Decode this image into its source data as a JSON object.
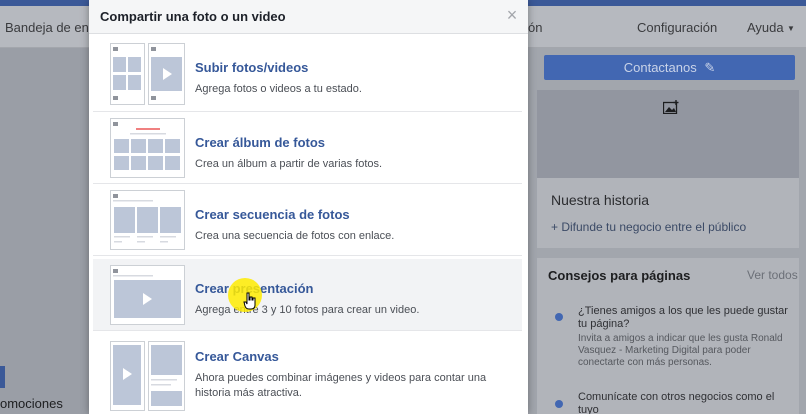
{
  "background": {
    "nav": {
      "inbox_partial": "Bandeja de entr",
      "notifications_partial": "ón",
      "settings": "Configuración",
      "help": "Ayuda",
      "help_caret": "▼"
    },
    "left_partial_text": "omociones",
    "contact_button": "Contactanos",
    "story": {
      "title": "Nuestra historia",
      "link": "+ Difunde tu negocio entre el público"
    },
    "tips": {
      "title": "Consejos para páginas",
      "see_all": "Ver todos",
      "items": [
        {
          "question": "¿Tienes amigos a los que les puede gustar tu página?",
          "sub": "Invita a amigos a indicar que les gusta Ronald Vasquez - Marketing Digital para poder conectarte con más personas."
        },
        {
          "question": "Comunícate con otros negocios como el tuyo"
        }
      ]
    }
  },
  "modal": {
    "title": "Compartir una foto o un video",
    "close_icon": "close-icon",
    "options": [
      {
        "label": "Subir fotos/videos",
        "description": "Agrega fotos o videos a tu estado."
      },
      {
        "label": "Crear álbum de fotos",
        "description": "Crea un álbum a partir de varias fotos."
      },
      {
        "label": "Crear secuencia de fotos",
        "description": "Crea una secuencia de fotos con enlace."
      },
      {
        "label": "Crear presentación",
        "description": "Agrega entre 3 y 10 fotos para crear un video."
      },
      {
        "label": "Crear Canvas",
        "description": "Ahora puedes combinar imágenes y videos para contar una historia más atractiva."
      }
    ]
  },
  "colors": {
    "facebook_blue": "#3b5998",
    "link_blue": "#365899",
    "button_blue": "#4267b2",
    "cursor_highlight": "#ffeb00"
  }
}
